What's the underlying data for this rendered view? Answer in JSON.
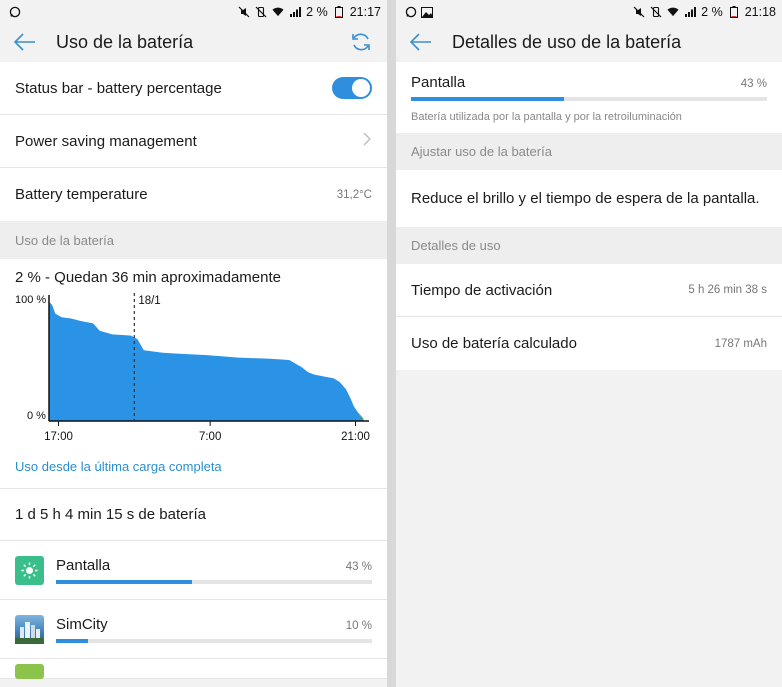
{
  "left": {
    "status": {
      "battery_text": "2 %",
      "time": "21:17"
    },
    "title": "Uso de la batería",
    "settings": [
      {
        "label": "Status bar - battery percentage"
      },
      {
        "label": "Power saving management"
      },
      {
        "label": "Battery temperature",
        "value": "31,2°C"
      }
    ],
    "section_header": "Uso de la batería",
    "graph_title": "2 % - Quedan 36 min aproximadamente",
    "chart_data": {
      "type": "area",
      "y_tick_labels": [
        "100 %",
        "0 %"
      ],
      "x_tick_labels": [
        "17:00",
        "7:00",
        "21:00"
      ],
      "marker_label": "18/1",
      "ylim": [
        0,
        100
      ],
      "x": [
        0,
        0.01,
        0.02,
        0.04,
        0.07,
        0.1,
        0.14,
        0.16,
        0.2,
        0.26,
        0.28,
        0.3,
        0.36,
        0.42,
        0.5,
        0.6,
        0.7,
        0.76,
        0.8,
        0.82,
        0.84,
        0.86,
        0.88,
        0.9,
        0.92,
        0.94,
        0.955,
        0.965,
        0.975,
        0.985,
        0.995
      ],
      "values": [
        98,
        95,
        88,
        85,
        84,
        82,
        80,
        74,
        71,
        70,
        67,
        58,
        56,
        55,
        54,
        52,
        51,
        50,
        44,
        40,
        38,
        37,
        36,
        35,
        32,
        26,
        18,
        12,
        8,
        4,
        2
      ]
    },
    "link_text": "Uso desde la última carga completa",
    "summary": "1 d 5 h 4 min 15 s de batería",
    "apps": [
      {
        "name": "Pantalla",
        "pct_text": "43 %",
        "pct": 43,
        "icon": "screen-brightness-icon",
        "color": "#3bbf8a"
      },
      {
        "name": "SimCity",
        "pct_text": "10 %",
        "pct": 10,
        "icon": "simcity-app-icon",
        "color": "#4a90c8"
      }
    ]
  },
  "right": {
    "status": {
      "battery_text": "2 %",
      "time": "21:18"
    },
    "title": "Detalles de uso de la batería",
    "item": {
      "name": "Pantalla",
      "pct_text": "43 %",
      "pct": 43,
      "description": "Batería utilizada por la pantalla y por la retroiluminación"
    },
    "adjust_header": "Ajustar uso de la batería",
    "adjust_tip": "Reduce el brillo y el tiempo de espera de la pantalla.",
    "details_header": "Detalles de uso",
    "details": [
      {
        "label": "Tiempo de activación",
        "value": "5 h 26 min 38 s"
      },
      {
        "label": "Uso de batería calculado",
        "value": "1787 mAh"
      }
    ]
  },
  "colors": {
    "accent": "#2f8fde",
    "link": "#2a8fcf",
    "chart_fill": "#2b93e6"
  }
}
